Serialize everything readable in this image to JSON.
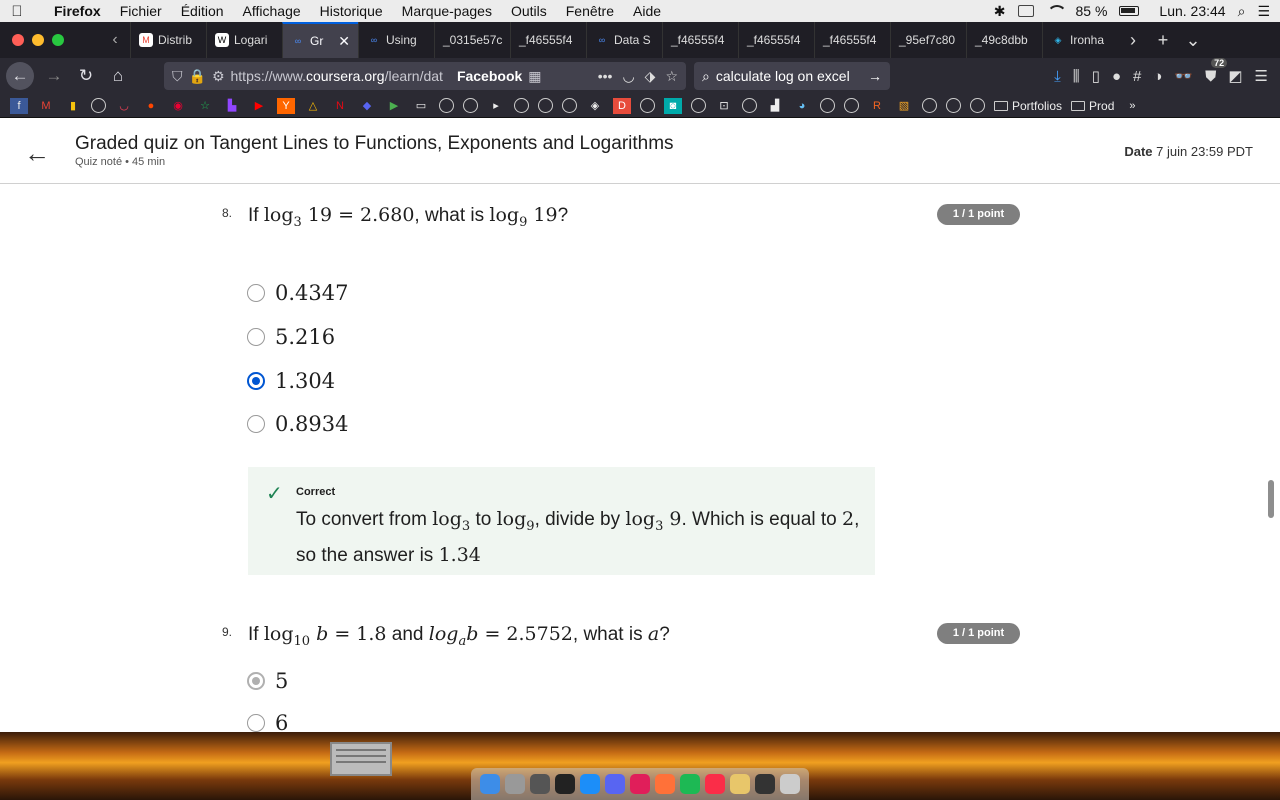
{
  "menubar": {
    "apple": "",
    "app": "Firefox",
    "items": [
      "Fichier",
      "Édition",
      "Affichage",
      "Historique",
      "Marque-pages",
      "Outils",
      "Fenêtre",
      "Aide"
    ],
    "battery": "85 %",
    "clock": "Lun. 23:44"
  },
  "tabs": [
    {
      "label": "Distrib",
      "icon": "gmail-icon",
      "color": "#ffffff",
      "glyph": "M"
    },
    {
      "label": "Logari",
      "icon": "wikipedia-icon",
      "color": "#ffffff",
      "glyph": "W"
    },
    {
      "label": "Gr",
      "icon": "coursera-icon",
      "color": "#4c8bf5",
      "glyph": "∞",
      "active": true
    },
    {
      "label": "Using",
      "icon": "coursera-icon",
      "color": "#4c8bf5",
      "glyph": "∞"
    },
    {
      "label": "_0315e57c",
      "icon": "",
      "color": "",
      "glyph": ""
    },
    {
      "label": "_f46555f4",
      "icon": "",
      "color": "",
      "glyph": ""
    },
    {
      "label": "Data S",
      "icon": "coursera-icon",
      "color": "#4c8bf5",
      "glyph": "∞"
    },
    {
      "label": "_f46555f4",
      "icon": "",
      "color": "",
      "glyph": ""
    },
    {
      "label": "_f46555f4",
      "icon": "",
      "color": "",
      "glyph": ""
    },
    {
      "label": "_f46555f4",
      "icon": "",
      "color": "",
      "glyph": ""
    },
    {
      "label": "_95ef7c80",
      "icon": "",
      "color": "",
      "glyph": ""
    },
    {
      "label": "_49c8dbb",
      "icon": "",
      "color": "",
      "glyph": ""
    },
    {
      "label": "Ironha",
      "icon": "ironhack-icon",
      "color": "#2fb5e8",
      "glyph": "◈"
    }
  ],
  "navbar": {
    "url_prefix": "https://www.",
    "url_domain": "coursera.org",
    "url_path": "/learn/dat",
    "reader_label": "Facebook",
    "search_value": "calculate log on excel",
    "addon_badge": "72"
  },
  "bookmarks": {
    "folders": [
      "Portfolios",
      "Prod"
    ]
  },
  "quiz": {
    "title": "Graded quiz on Tangent Lines to Functions, Exponents and Logarithms",
    "subtitle": "Quiz noté • 45  min",
    "due_label": "Date",
    "due_value": "7 juin 23:59 PDT"
  },
  "q8": {
    "number": "8.",
    "points": "1 / 1 point",
    "options": [
      "0.4347",
      "5.216",
      "1.304",
      "0.8934"
    ],
    "selected_index": 2,
    "feedback_label": "Correct"
  },
  "q9": {
    "number": "9.",
    "points": "1 / 1 point",
    "options": [
      "5",
      "6"
    ]
  }
}
